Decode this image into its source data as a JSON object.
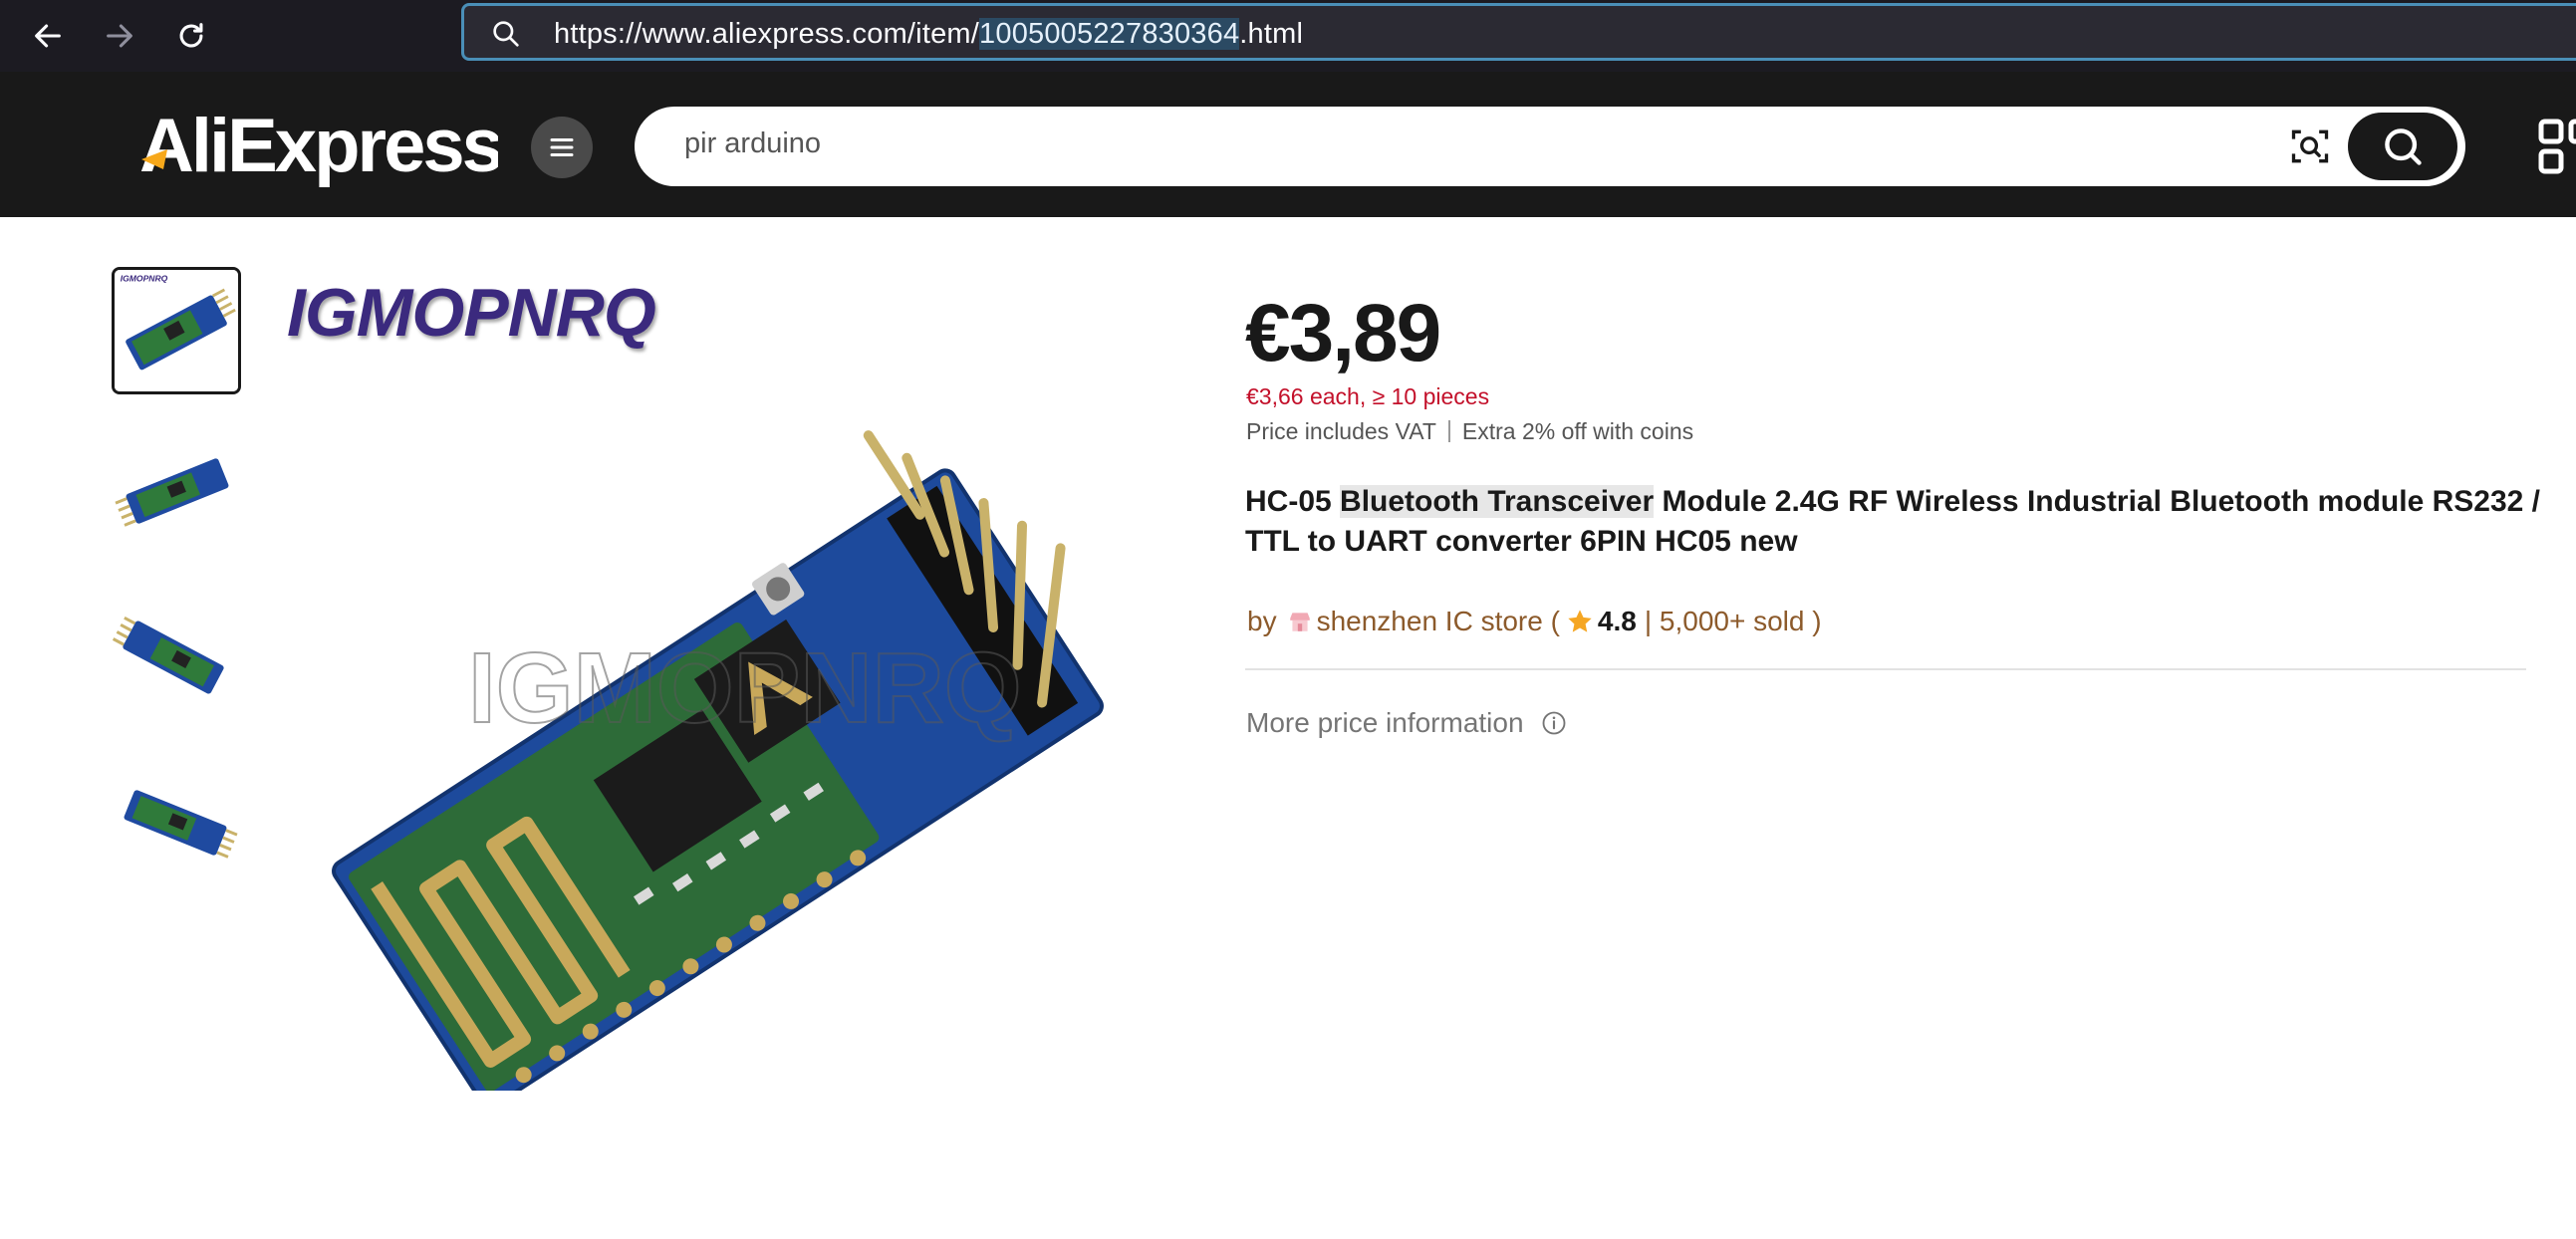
{
  "browser": {
    "url_prefix": "https://www.aliexpress.com/item/",
    "url_selected": "1005005227830364",
    "url_suffix": ".html"
  },
  "header": {
    "logo_text": "AliExpress",
    "search_value": "pir arduino",
    "brand_color": "#191919"
  },
  "gallery": {
    "thumbnails": [
      "thumbnail-1",
      "thumbnail-2",
      "thumbnail-3",
      "thumbnail-4"
    ],
    "active_index": 0,
    "brand_mark": "IGMOPNRQ"
  },
  "product": {
    "price": "€3,89",
    "bulk_price": "€3,66 each, ≥ 10 pieces",
    "vat_note": "Price includes VAT",
    "coins_note": "Extra 2% off with coins",
    "title_pre": "HC-05 ",
    "title_highlight": "Bluetooth Transceiver",
    "title_post": " Module 2.4G RF Wireless Industrial Bluetooth module RS232 / TTL to UART converter 6PIN HC05 new",
    "store_by": "by",
    "store_name": "shenzhen IC store (",
    "rating": "4.8",
    "sold": "| 5,000+ sold )",
    "more_price": "More price information",
    "accent_red": "#c3102a",
    "store_color": "#8c5a2b"
  }
}
